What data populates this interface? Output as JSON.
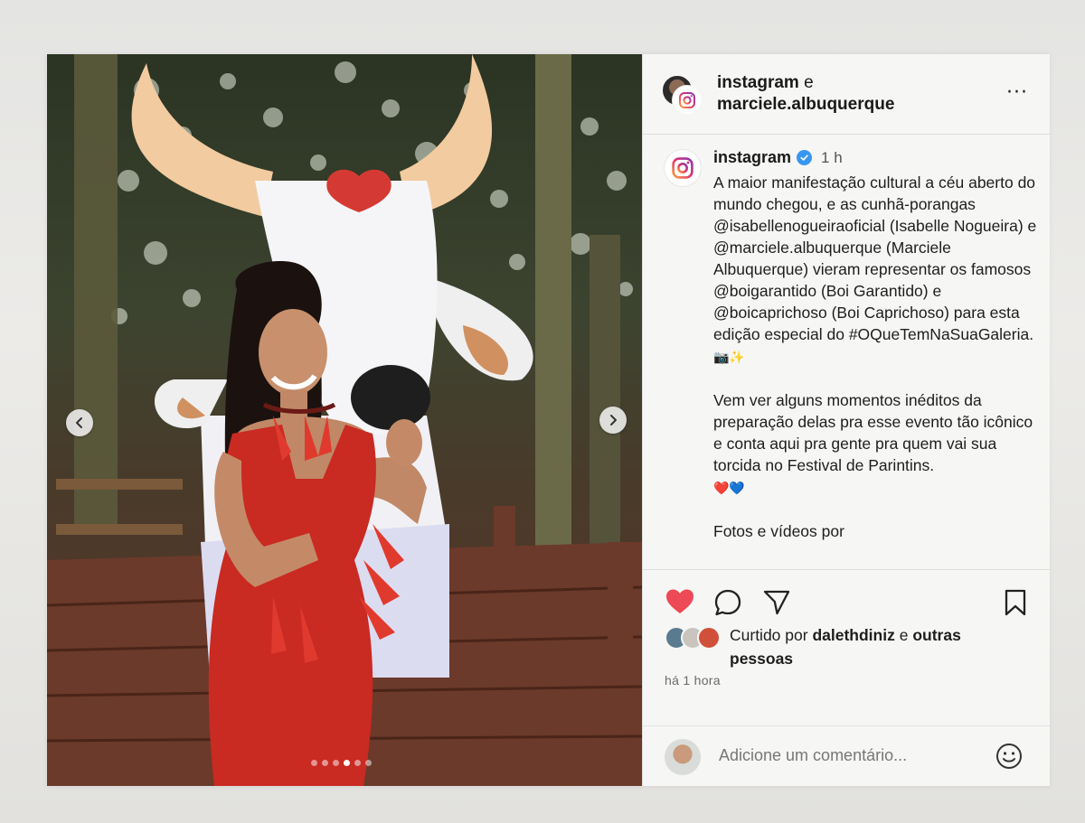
{
  "post": {
    "header": {
      "account1": "instagram",
      "joiner": "e",
      "account2": "marciele.albuquerque",
      "more_label": "···"
    },
    "caption": {
      "username": "instagram",
      "time": "1 h",
      "paragraph1": "A maior manifestação cultural a céu aberto do mundo chegou, e as cunhã-porangas @isabellenogueiraoficial (Isabelle Nogueira) e @marciele.albuquerque (Marciele Albuquerque) vieram representar os famosos @boigarantido (Boi Garantido) e @boicaprichoso (Boi Caprichoso) para esta edição especial do #OQueTemNaSuaGaleria.",
      "paragraph1_emoji": "📷✨",
      "paragraph2": "Vem ver alguns momentos inéditos da preparação delas pra esse evento tão icônico e conta aqui pra gente pra quem vai sua torcida no Festival de Parintins.",
      "paragraph2_emoji": "❤️💙",
      "paragraph3": "Fotos e vídeos por"
    },
    "likes": {
      "prefix": "Curtido por",
      "user": "dalethdiniz",
      "joiner": "e",
      "others": "outras pessoas"
    },
    "timestamp": "há 1 hora",
    "comment_placeholder": "Adicione um comentário...",
    "carousel": {
      "total": 6,
      "current": 4
    }
  },
  "colors": {
    "like_red": "#ed4956",
    "verified_blue": "#3897f0",
    "dress_red": "#c92a22"
  }
}
